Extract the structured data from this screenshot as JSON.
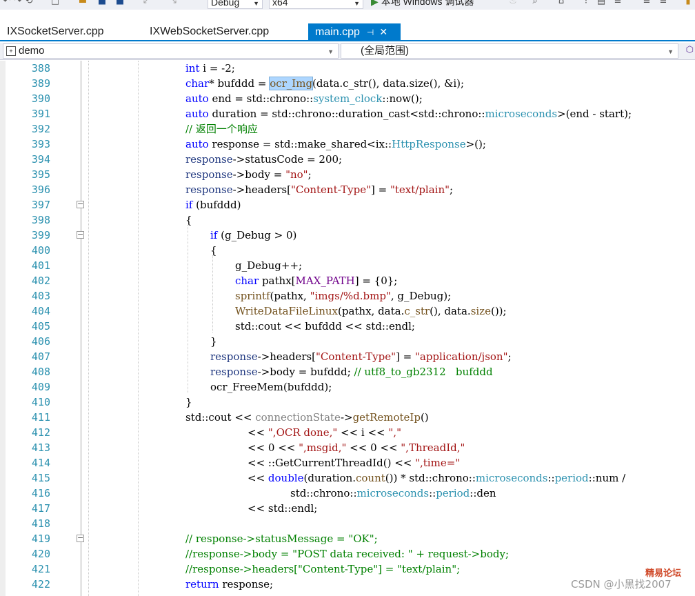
{
  "toolbar": {
    "config": "Debug",
    "platform": "x64",
    "run_label": "本地 Windows 调试器"
  },
  "tabs": [
    {
      "label": "IXSocketServer.cpp",
      "active": false
    },
    {
      "label": "IXWebSocketServer.cpp",
      "active": false
    },
    {
      "label": "main.cpp",
      "active": true
    }
  ],
  "navbar": {
    "project": "demo",
    "scope": "(全局范围)"
  },
  "editor": {
    "lines": [
      {
        "n": "388"
      },
      {
        "n": "389"
      },
      {
        "n": "390"
      },
      {
        "n": "391"
      },
      {
        "n": "392"
      },
      {
        "n": "393"
      },
      {
        "n": "394"
      },
      {
        "n": "395"
      },
      {
        "n": "396"
      },
      {
        "n": "397"
      },
      {
        "n": "398"
      },
      {
        "n": "399"
      },
      {
        "n": "400"
      },
      {
        "n": "401"
      },
      {
        "n": "402"
      },
      {
        "n": "403"
      },
      {
        "n": "404"
      },
      {
        "n": "405"
      },
      {
        "n": "406"
      },
      {
        "n": "407"
      },
      {
        "n": "408"
      },
      {
        "n": "409"
      },
      {
        "n": "410"
      },
      {
        "n": "411"
      },
      {
        "n": "412"
      },
      {
        "n": "413"
      },
      {
        "n": "414"
      },
      {
        "n": "415"
      },
      {
        "n": "416"
      },
      {
        "n": "417"
      },
      {
        "n": "418"
      },
      {
        "n": "419"
      },
      {
        "n": "420"
      },
      {
        "n": "421"
      },
      {
        "n": "422"
      }
    ],
    "code": {
      "l388": [
        "int",
        " i = -2;"
      ],
      "l389": [
        "char",
        "* bufddd = ",
        "ocr_Img",
        "(data.c_str(), data.size(), &i);"
      ],
      "l390": [
        "auto",
        " end = std::chrono::",
        "system_clock",
        "::now();"
      ],
      "l391": [
        "auto",
        " duration = std::chrono::duration_cast<std::chrono::",
        "microseconds",
        ">(end - start);"
      ],
      "l392": [
        "// 返回一个响应"
      ],
      "l393": [
        "auto",
        " response = std::make_shared<ix::",
        "HttpResponse",
        ">();"
      ],
      "l394": [
        "response",
        "->statusCode = 200;"
      ],
      "l395": [
        "response",
        "->body = ",
        "\"no\"",
        ";"
      ],
      "l396": [
        "response",
        "->headers[",
        "\"Content-Type\"",
        "] = ",
        "\"text/plain\"",
        ";"
      ],
      "l397": [
        "if",
        " (bufddd)"
      ],
      "l398": [
        "{"
      ],
      "l399": [
        "if",
        " (g_Debug > 0)"
      ],
      "l400": [
        "{"
      ],
      "l401": [
        "g_Debug++;"
      ],
      "l402": [
        "char",
        " pathx[",
        "MAX_PATH",
        "] = {0};"
      ],
      "l403": [
        "sprintf",
        "(pathx, ",
        "\"imgs/%d.bmp\"",
        ", g_Debug);"
      ],
      "l404": [
        "WriteDataFileLinux",
        "(pathx, data.",
        "c_str",
        "(), data.",
        "size",
        "());"
      ],
      "l405": [
        "std::cout << bufddd << std::endl;"
      ],
      "l406": [
        "}"
      ],
      "l407": [
        "response",
        "->headers[",
        "\"Content-Type\"",
        "] = ",
        "\"application/json\"",
        ";"
      ],
      "l408": [
        "response",
        "->body = bufddd; ",
        "// utf8_to_gb2312   bufddd"
      ],
      "l409": [
        "ocr_FreeMem(bufddd);"
      ],
      "l410": [
        "}"
      ],
      "l411": [
        "std::cout << ",
        "connectionState",
        "->",
        "getRemoteIp",
        "()"
      ],
      "l412": [
        "<< ",
        "\",OCR done,\"",
        " << i << ",
        "\",\""
      ],
      "l413": [
        "<< 0 << ",
        "\",msgid,\"",
        " << 0 << ",
        "\",ThreadId,\""
      ],
      "l414": [
        "<< ::GetCurrentThreadId() << ",
        "\",time=\""
      ],
      "l415": [
        "<< ",
        "double",
        "(duration.",
        "count",
        "()) * std::chrono::",
        "microseconds",
        "::",
        "period",
        "::num /"
      ],
      "l416": [
        "std::chrono::",
        "microseconds",
        "::",
        "period",
        "::den"
      ],
      "l417": [
        "<< std::endl;"
      ],
      "l418": [
        ""
      ],
      "l419": [
        "// response->statusMessage = \"OK\";"
      ],
      "l420": [
        "//response->body = \"POST data received: \" + request->body;"
      ],
      "l421": [
        "//response->headers[\"Content-Type\"] = \"text/plain\";"
      ],
      "l422": [
        "return",
        " response;"
      ]
    }
  },
  "watermark": {
    "forum": "精易论坛",
    "csdn": "CSDN @小黑找2007"
  },
  "colors": {
    "accent": "#007acc",
    "keyword": "#0000ff",
    "type": "#2b91af",
    "string": "#a31515",
    "comment": "#008000",
    "line_number": "#2b91af"
  }
}
